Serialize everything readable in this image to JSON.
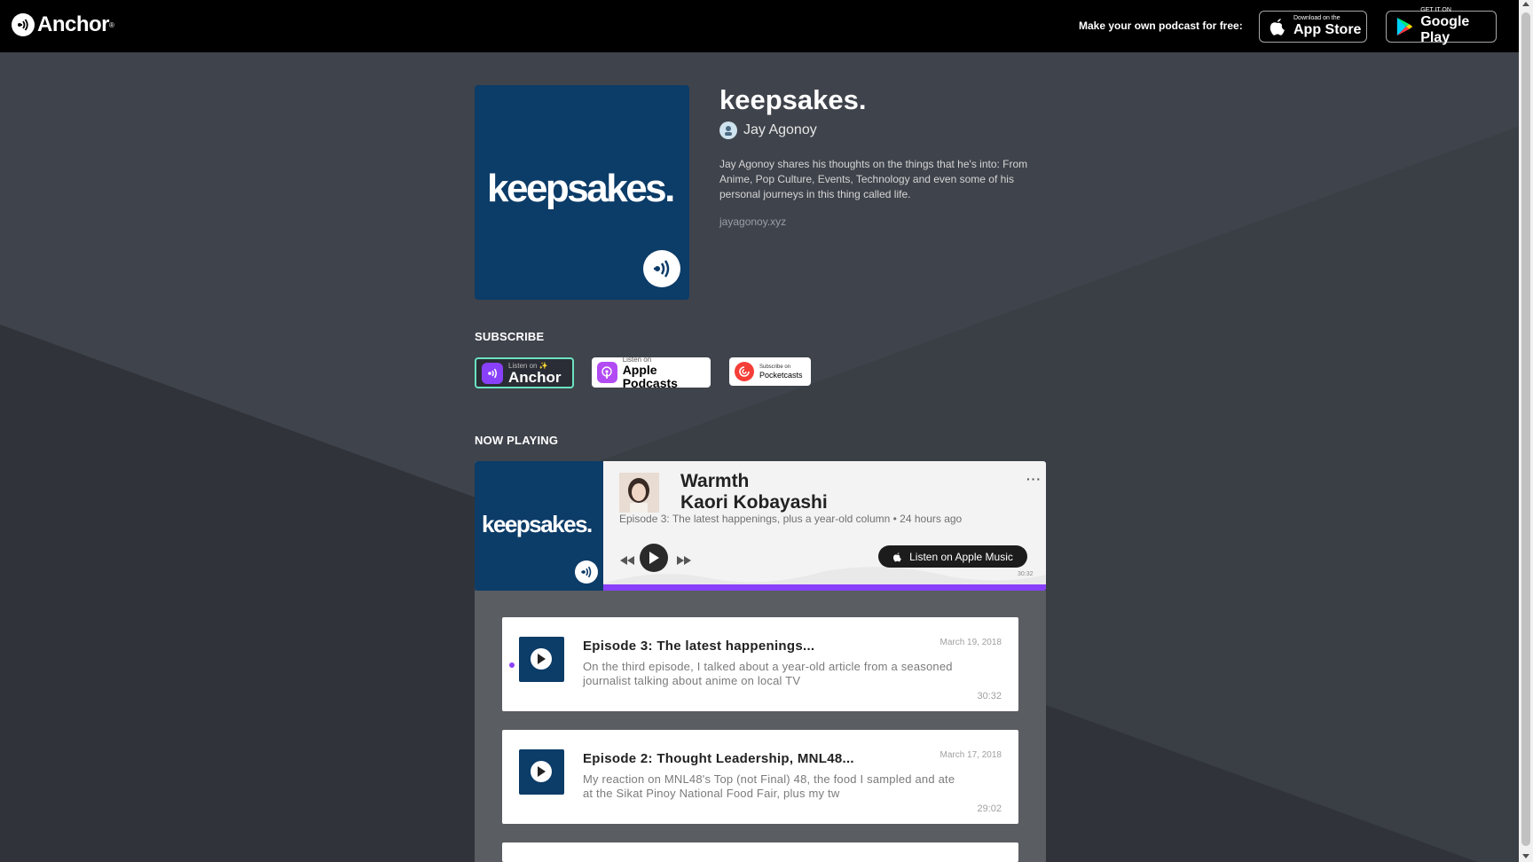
{
  "header": {
    "logo_text": "Anchor",
    "logo_reg": "®",
    "make_own_text": "Make your own podcast for free:",
    "app_store": {
      "small": "Download on the",
      "big": "App Store"
    },
    "google_play": {
      "small": "GET IT ON",
      "big": "Google Play"
    }
  },
  "podcast": {
    "cover_text": "keepsakes.",
    "title": "keepsakes.",
    "author": "Jay Agonoy",
    "description": "Jay Agonoy shares his thoughts on the things that he's into: From Anime, Pop Culture, Events, Technology and even some of his personal journeys in this thing called life.",
    "website": "jayagonoy.xyz"
  },
  "subscribe": {
    "label": "SUBSCRIBE",
    "anchor": {
      "small": "Listen on ✨",
      "big": "Anchor"
    },
    "apple": {
      "small": "Listen on",
      "big": "Apple Podcasts"
    },
    "pocketcasts": {
      "small": "Subscribe on",
      "big": "Pocketcasts"
    }
  },
  "now_playing": {
    "label": "NOW PLAYING",
    "art_text": "keepsakes.",
    "track_title_line1": "Warmth",
    "track_title_line2": "Kaori Kobayashi",
    "subtitle": "Episode 3: The latest happenings, plus a year-old column • 24 hours ago",
    "more": "···",
    "apple_music_label": "Listen on Apple Music",
    "duration": "30:32",
    "progress": 1.0
  },
  "episodes": [
    {
      "title": "Episode 3: The latest happenings...",
      "description": "On the third episode, I talked about a year-old article from a seasoned journalist talking about anime on local TV",
      "date": "March 19, 2018",
      "duration": "30:32",
      "active": true
    },
    {
      "title": "Episode 2: Thought Leadership, MNL48...",
      "description": "My reaction on MNL48's Top (not Final) 48, the food I sampled and ate at the Sikat Pinoy National Food Fair, plus my tw",
      "date": "March 17, 2018",
      "duration": "29:02",
      "active": false
    }
  ],
  "colors": {
    "accent": "#8940fa",
    "cover_bg": "#0c3c68",
    "anchor_border": "#6be3c2"
  }
}
